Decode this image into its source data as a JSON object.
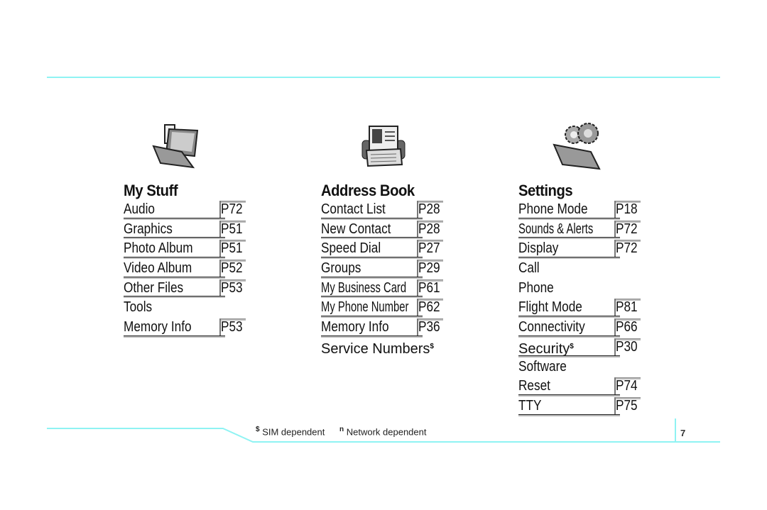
{
  "columns": [
    {
      "title": "My Stuff",
      "icon": "folder-media-icon",
      "items": [
        {
          "label": "Audio",
          "page": "P72"
        },
        {
          "label": "Graphics",
          "page": "P51"
        },
        {
          "label": "Photo Album",
          "page": "P51"
        },
        {
          "label": "Video Album",
          "page": "P52"
        },
        {
          "label": "Other Files",
          "page": "P53"
        },
        {
          "label": "Tools",
          "page": ""
        },
        {
          "label": "Memory Info",
          "page": "P53"
        }
      ]
    },
    {
      "title": "Address Book",
      "icon": "rolodex-contact-icon",
      "items": [
        {
          "label": "Contact List",
          "page": "P28"
        },
        {
          "label": "New Contact",
          "page": "P28"
        },
        {
          "label": "Speed Dial",
          "page": "P27"
        },
        {
          "label": "Groups",
          "page": "P29"
        },
        {
          "label": "My Business Card",
          "page": "P61"
        },
        {
          "label": "My Phone Number",
          "page": "P62"
        },
        {
          "label": "Memory Info",
          "page": "P36"
        },
        {
          "label": "Service Numbers",
          "page": "",
          "mark": "$"
        }
      ]
    },
    {
      "title": "Settings",
      "icon": "folder-gears-icon",
      "items": [
        {
          "label": "Phone Mode",
          "page": "P18"
        },
        {
          "label": "Sounds & Alerts",
          "page": "P72"
        },
        {
          "label": "Display",
          "page": "P72"
        },
        {
          "label": "Call",
          "page": ""
        },
        {
          "label": "Phone",
          "page": ""
        },
        {
          "label": "Flight Mode",
          "page": "P81"
        },
        {
          "label": "Connectivity",
          "page": "P66"
        },
        {
          "label": "Security",
          "page": "P30",
          "mark": "$"
        },
        {
          "label": "Software",
          "page": ""
        },
        {
          "label": "Reset",
          "page": "P74"
        },
        {
          "label": "TTY",
          "page": "P75"
        }
      ]
    }
  ],
  "footer": {
    "sim_mark": "$",
    "sim_text": "SIM dependent",
    "network_mark": "n",
    "network_text": "Network dependent",
    "page_number": "7"
  }
}
